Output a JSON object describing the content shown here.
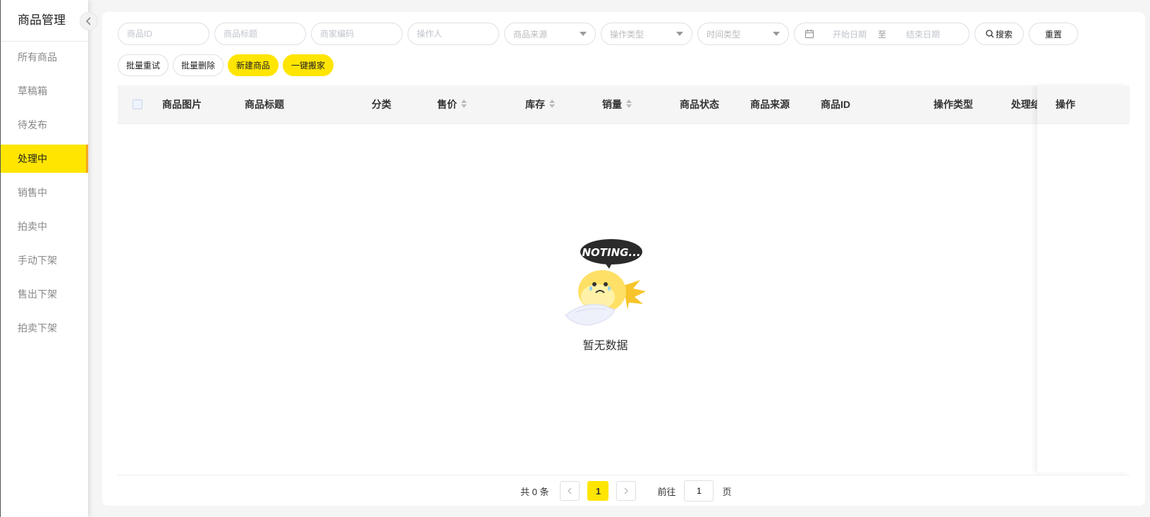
{
  "sidebar": {
    "title": "商品管理",
    "items": [
      {
        "label": "所有商品"
      },
      {
        "label": "草稿箱"
      },
      {
        "label": "待发布"
      },
      {
        "label": "处理中"
      },
      {
        "label": "销售中"
      },
      {
        "label": "拍卖中"
      },
      {
        "label": "手动下架"
      },
      {
        "label": "售出下架"
      },
      {
        "label": "拍卖下架"
      }
    ],
    "active_index": 3
  },
  "filters": {
    "product_id_placeholder": "商品ID",
    "product_title_placeholder": "商品标题",
    "merchant_code_placeholder": "商家编码",
    "operator_placeholder": "操作人",
    "source_select": "商品来源",
    "operation_type_select": "操作类型",
    "time_type_select": "时间类型",
    "start_date_placeholder": "开始日期",
    "date_separator": "至",
    "end_date_placeholder": "结束日期",
    "search_label": "搜索",
    "reset_label": "重置"
  },
  "actions": {
    "batch_retry": "批量重试",
    "batch_delete": "批量删除",
    "new_product": "新建商品",
    "one_click_move": "一键搬家"
  },
  "table": {
    "columns": [
      "商品图片",
      "商品标题",
      "分类",
      "售价",
      "库存",
      "销量",
      "商品状态",
      "商品来源",
      "商品ID",
      "操作类型",
      "处理结果",
      "操作"
    ],
    "empty_badge": "NOTING...",
    "empty_text": "暂无数据"
  },
  "pagination": {
    "total_text": "共 0 条",
    "current_page": "1",
    "goto_label": "前往",
    "goto_value": "1",
    "page_suffix": "页"
  },
  "colors": {
    "accent": "#ffe500",
    "active_border": "#f5a623"
  }
}
